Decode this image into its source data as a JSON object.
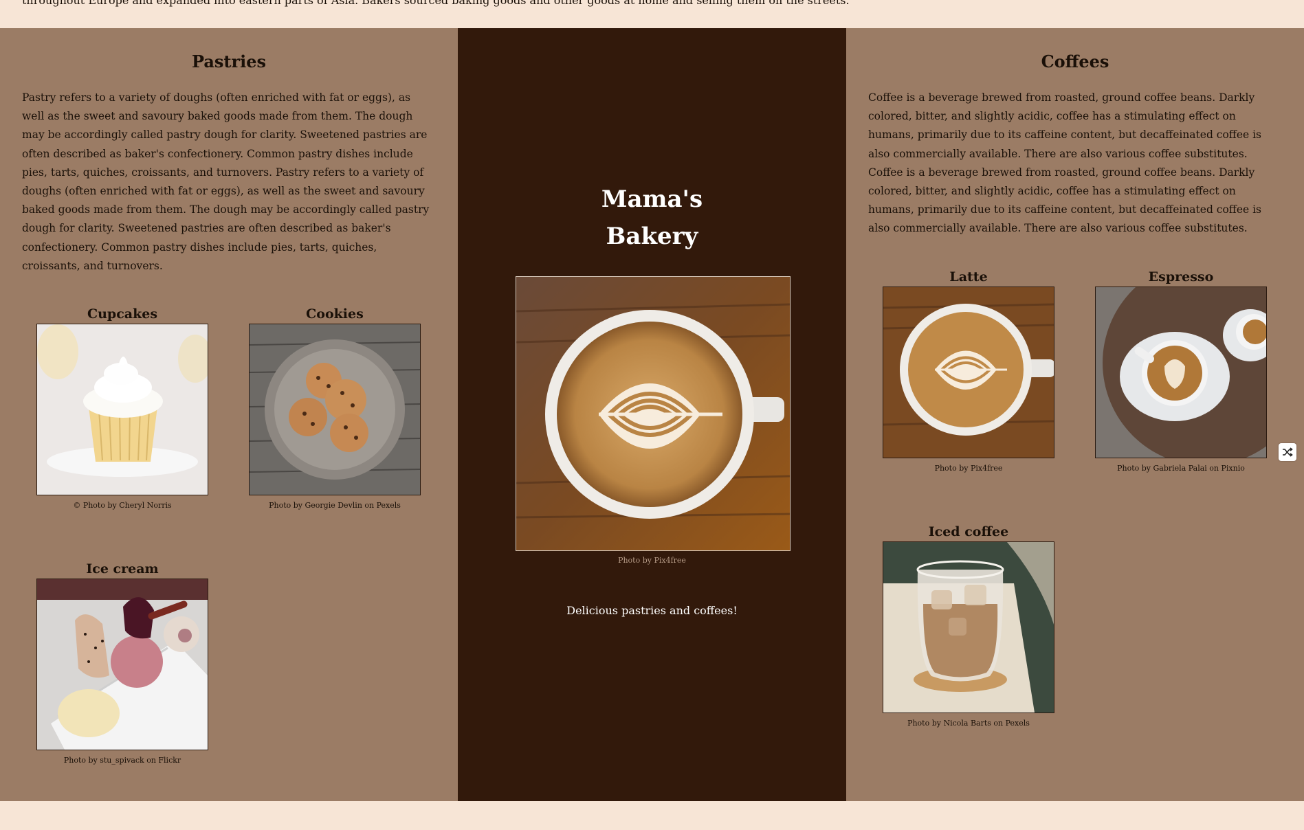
{
  "intro_text": "throughout Europe and expanded into eastern parts of Asia. Bakers sourced baking goods and other goods at home and selling them on the streets.",
  "pastries": {
    "title": "Pastries",
    "description": "Pastry refers to a variety of doughs (often enriched with fat or eggs), as well as the sweet and savoury baked goods made from them. The dough may be accordingly called pastry dough for clarity. Sweetened pastries are often described as baker's confectionery. Common pastry dishes include pies, tarts, quiches, croissants, and turnovers. Pastry refers to a variety of doughs (often enriched with fat or eggs), as well as the sweet and savoury baked goods made from them. The dough may be accordingly called pastry dough for clarity. Sweetened pastries are often described as baker's confectionery. Common pastry dishes include pies, tarts, quiches, croissants, and turnovers.",
    "items": [
      {
        "name": "Cupcakes",
        "credit": "© Photo by Cheryl Norris",
        "image": "cupcake-photo"
      },
      {
        "name": "Cookies",
        "credit": "Photo by Georgie Devlin on Pexels",
        "image": "cookies-photo"
      },
      {
        "name": "Ice cream",
        "credit": "Photo by stu_spivack on Flickr",
        "image": "ice-cream-photo"
      }
    ]
  },
  "center": {
    "title_line1": "Mama's",
    "title_line2": "Bakery",
    "hero_credit": "Photo by Pix4free",
    "tagline": "Delicious pastries and coffees!"
  },
  "coffees": {
    "title": "Coffees",
    "description": "Coffee is a beverage brewed from roasted, ground coffee beans. Darkly colored, bitter, and slightly acidic, coffee has a stimulating effect on humans, primarily due to its caffeine content, but decaffeinated coffee is also commercially available. There are also various coffee substitutes. Coffee is a beverage brewed from roasted, ground coffee beans. Darkly colored, bitter, and slightly acidic, coffee has a stimulating effect on humans, primarily due to its caffeine content, but decaffeinated coffee is also commercially available. There are also various coffee substitutes.",
    "items": [
      {
        "name": "Latte",
        "credit": "Photo by Pix4free",
        "image": "latte-photo"
      },
      {
        "name": "Espresso",
        "credit": "Photo by Gabriela Palai on Pixnio",
        "image": "espresso-photo"
      },
      {
        "name": "Iced coffee",
        "credit": "Photo by Nicola Barts on Pexels",
        "image": "iced-coffee-photo"
      }
    ]
  },
  "controls": {
    "shuffle_icon": "shuffle-icon"
  },
  "colors": {
    "page_bg": "#f7e5d6",
    "side_bg": "#9b7c65",
    "center_bg": "#32190b"
  }
}
